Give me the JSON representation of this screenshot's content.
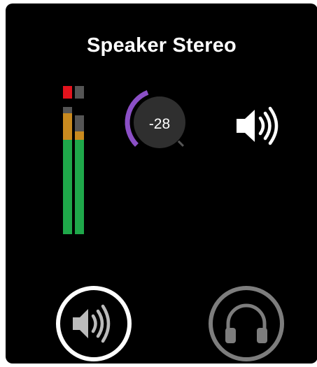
{
  "title": "Speaker Stereo",
  "meters": {
    "left": {
      "level": 0.92,
      "peak": 0.97,
      "clip": true
    },
    "right": {
      "level": 0.78,
      "peak": 0.9,
      "clip": false
    }
  },
  "gain_knob": {
    "value_label": "-28",
    "fill_fraction": 0.42
  },
  "icons": {
    "speaker": "speaker-volume-icon",
    "speaker_button": "speaker-output-icon",
    "headphones_button": "headphones-icon"
  },
  "output": {
    "selected": "speaker"
  },
  "colors": {
    "background": "#000000",
    "text": "#ffffff",
    "accent": "#8b4fc6",
    "meter_green": "#1fa84a",
    "meter_yellow": "#d9b51c",
    "meter_orange": "#c98a1f",
    "meter_red": "#e3131d",
    "meter_dark": "#555555",
    "inactive": "#7d7d7d"
  }
}
